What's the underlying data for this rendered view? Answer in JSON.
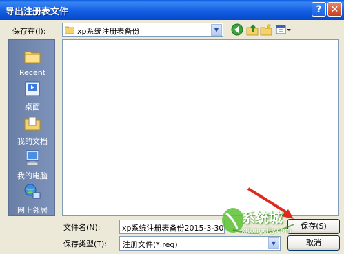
{
  "window": {
    "title": "导出注册表文件"
  },
  "titlebar": {
    "help_icon": "?",
    "close_icon": "✕"
  },
  "save_in": {
    "label": "保存在(I):",
    "value": "xp系统注册表备份"
  },
  "toolbar": [
    "back-icon",
    "up-folder-icon",
    "new-folder-icon",
    "views-icon"
  ],
  "places": [
    {
      "label": "Recent",
      "icon": "recent-folder-icon"
    },
    {
      "label": "桌面",
      "icon": "desktop-icon"
    },
    {
      "label": "我的文档",
      "icon": "my-documents-icon"
    },
    {
      "label": "我的电脑",
      "icon": "my-computer-icon"
    },
    {
      "label": "网上邻居",
      "icon": "network-icon"
    }
  ],
  "filename": {
    "label": "文件名(N):",
    "value": "xp系统注册表备份2015-3-30"
  },
  "filetype": {
    "label": "保存类型(T):",
    "value": "注册文件(*.reg)"
  },
  "buttons": {
    "save": "保存(S)",
    "cancel": "取消"
  },
  "watermark": {
    "text": "系统城",
    "url": "xitongcity.com"
  },
  "colors": {
    "title_blue": "#0a52d6",
    "dialog_bg": "#ece9d8",
    "places_bg": "#6a7fa6",
    "arrow_red": "#e02a1e"
  }
}
